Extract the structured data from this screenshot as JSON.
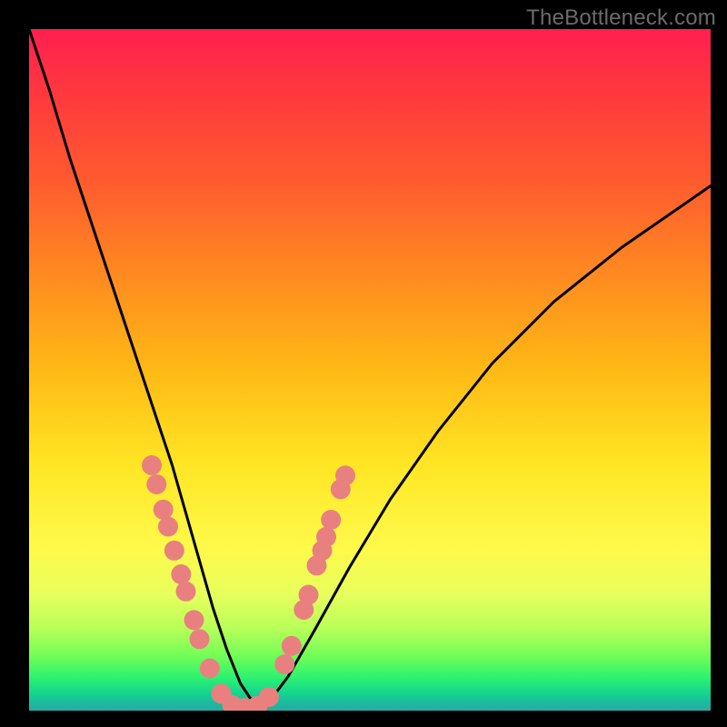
{
  "watermark": "TheBottleneck.com",
  "chart_data": {
    "type": "line",
    "title": "",
    "xlabel": "",
    "ylabel": "",
    "xlim": [
      0,
      100
    ],
    "ylim": [
      0,
      100
    ],
    "grid": false,
    "legend": false,
    "series": [
      {
        "name": "bottleneck-curve",
        "x": [
          0,
          3,
          6,
          9,
          12,
          15,
          18,
          21,
          23,
          25,
          27,
          29,
          31,
          33,
          35,
          38,
          42,
          47,
          53,
          60,
          68,
          77,
          87,
          100
        ],
        "y": [
          100,
          91,
          81,
          72,
          63,
          54,
          45,
          36,
          29,
          22,
          15,
          9,
          4,
          1,
          1,
          5,
          12,
          21,
          31,
          41,
          51,
          60,
          68,
          77
        ]
      }
    ],
    "markers": {
      "name": "highlight-dots",
      "color": "#e98080",
      "radius_px": 11,
      "points_xy": [
        [
          18.0,
          36.0
        ],
        [
          18.7,
          33.2
        ],
        [
          19.7,
          29.5
        ],
        [
          20.4,
          27.0
        ],
        [
          21.3,
          23.5
        ],
        [
          22.3,
          20.0
        ],
        [
          23.0,
          17.5
        ],
        [
          24.2,
          13.3
        ],
        [
          25.0,
          10.5
        ],
        [
          26.5,
          6.2
        ],
        [
          28.2,
          2.5
        ],
        [
          29.8,
          0.8
        ],
        [
          31.7,
          0.4
        ],
        [
          33.5,
          0.7
        ],
        [
          35.2,
          2.0
        ],
        [
          37.5,
          6.8
        ],
        [
          38.5,
          9.5
        ],
        [
          40.3,
          14.8
        ],
        [
          41.0,
          17.0
        ],
        [
          42.2,
          21.3
        ],
        [
          43.0,
          23.5
        ],
        [
          43.6,
          25.5
        ],
        [
          44.3,
          28.0
        ],
        [
          45.7,
          32.5
        ],
        [
          46.4,
          34.5
        ]
      ]
    },
    "background_gradient": {
      "top": "#ff1f4f",
      "mid": "#ffe624",
      "bottom": "#2aa8a1"
    }
  }
}
